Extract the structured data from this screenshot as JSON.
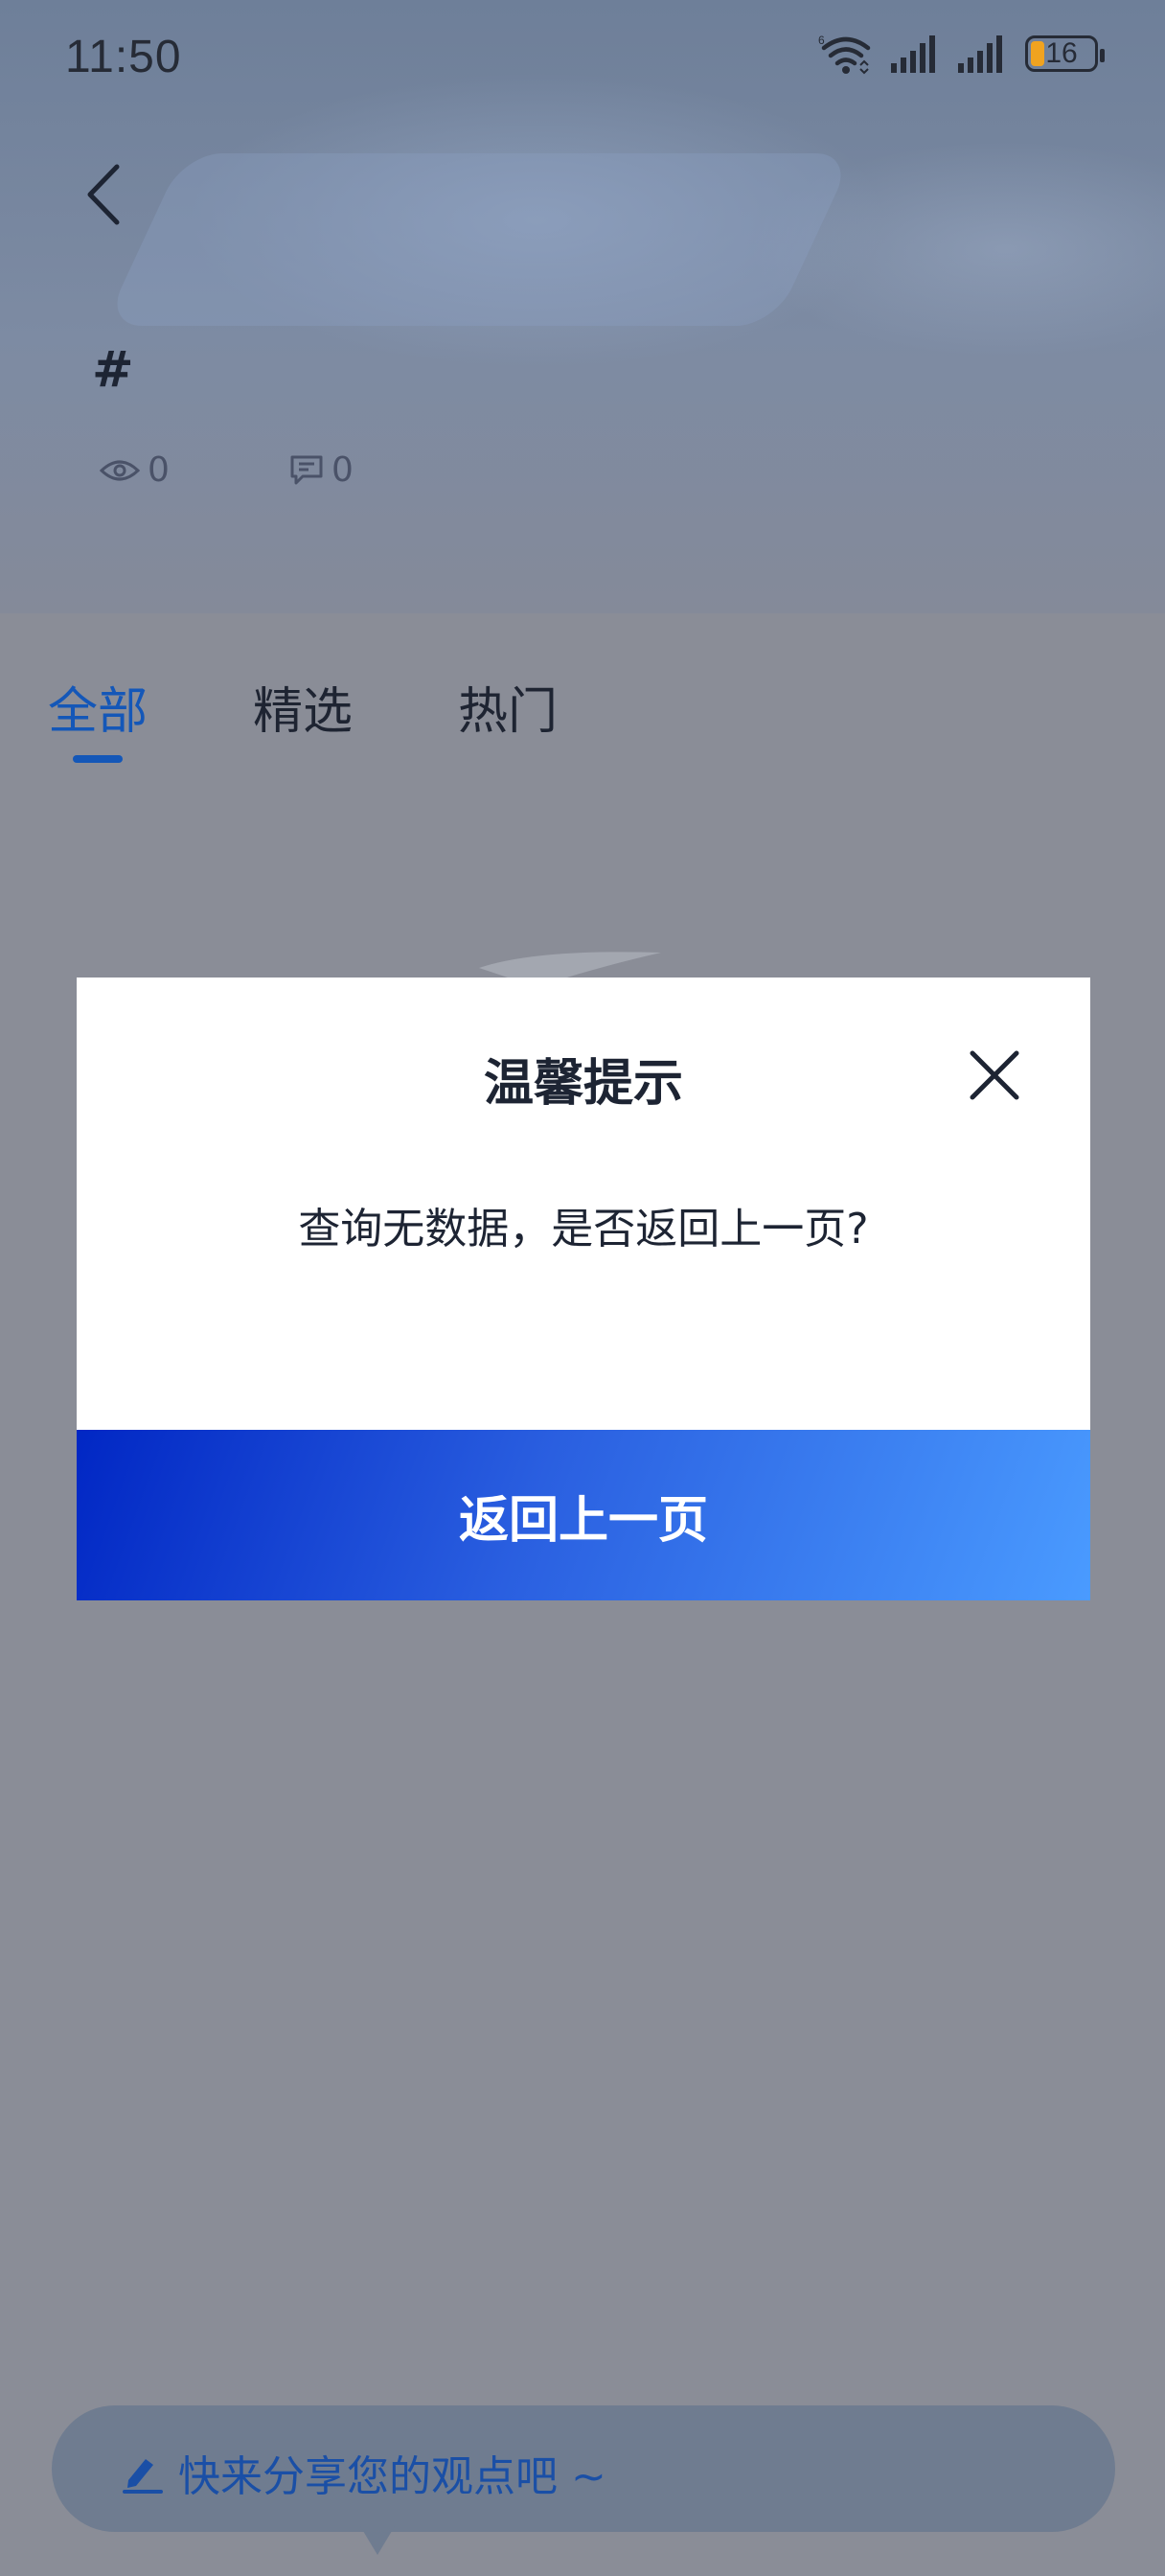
{
  "status_bar": {
    "time": "11:50",
    "battery_level": "16",
    "battery_color": "#f0a320",
    "icons": [
      "wifi-6-icon",
      "signal-icon",
      "signal-icon",
      "battery-icon"
    ]
  },
  "header": {
    "back_icon": "chevron-left-icon",
    "topic_title": "#",
    "views_icon": "eye-icon",
    "views_count": "0",
    "comments_icon": "comment-icon",
    "comments_count": "0"
  },
  "tabs": [
    {
      "label": "全部",
      "active": true
    },
    {
      "label": "精选",
      "active": false
    },
    {
      "label": "热门",
      "active": false
    }
  ],
  "accent_color": "#1457b8",
  "comment_bar": {
    "icon": "edit-pen-icon",
    "placeholder": "快来分享您的观点吧 ~"
  },
  "modal": {
    "title": "温馨提示",
    "close_icon": "close-icon",
    "message": "查询无数据，是否返回上一页?",
    "confirm_label": "返回上一页",
    "confirm_gradient": [
      "#0127c4",
      "#4a9bff"
    ]
  }
}
